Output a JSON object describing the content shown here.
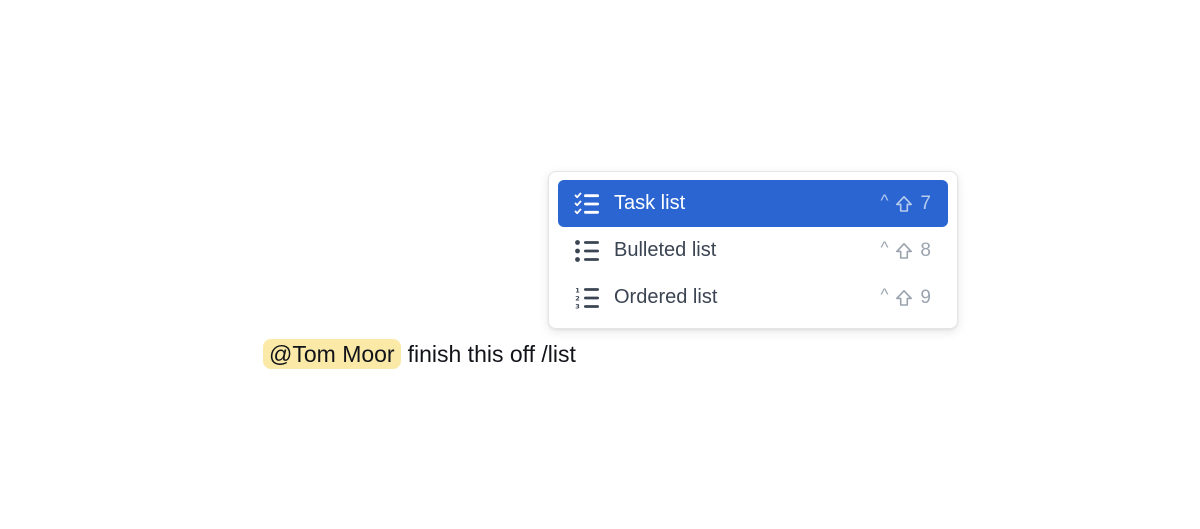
{
  "editor": {
    "mention": "@Tom Moor",
    "text": "finish this off /list"
  },
  "menu": {
    "items": [
      {
        "label": "Task list",
        "icon": "checklist-icon",
        "shortcut": {
          "ctrl": "^",
          "shift": "shift-arrow-icon",
          "key": "7"
        },
        "selected": true
      },
      {
        "label": "Bulleted list",
        "icon": "bulleted-list-icon",
        "shortcut": {
          "ctrl": "^",
          "shift": "shift-arrow-icon",
          "key": "8"
        },
        "selected": false
      },
      {
        "label": "Ordered list",
        "icon": "ordered-list-icon",
        "shortcut": {
          "ctrl": "^",
          "shift": "shift-arrow-icon",
          "key": "9"
        },
        "selected": false
      }
    ]
  },
  "colors": {
    "selected_bg": "#2a65d1",
    "mention_bg": "#fbe9a7",
    "shortcut_text": "#9aa3ae"
  }
}
